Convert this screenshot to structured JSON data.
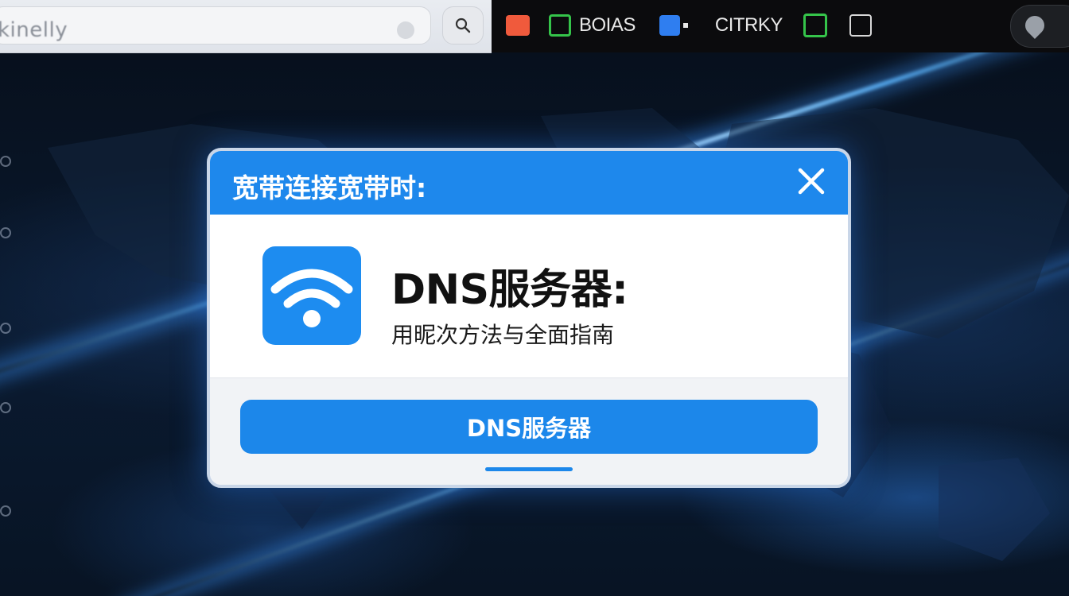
{
  "browser": {
    "address_text": "kinelly",
    "toolbar_items": [
      {
        "icon": "folder-icon",
        "color": "#f05a3c",
        "label": ""
      },
      {
        "icon": "chip-icon",
        "color": "#35c44a",
        "label": "BOIAS"
      },
      {
        "icon": "document-icon",
        "color": "#2f7ef0",
        "label": ""
      },
      {
        "icon": "",
        "color": "",
        "label": "CITRKY"
      },
      {
        "icon": "clipboard-icon",
        "color": "#35c44a",
        "label": ""
      },
      {
        "icon": "grid-icon",
        "color": "#d8d8d8",
        "label": ""
      }
    ]
  },
  "dialog": {
    "title": "宽带连接宽带时:",
    "heading": "DNS服务器:",
    "subtitle": "用昵次方法与全面指南",
    "button_label": "DNS服务器",
    "colors": {
      "accent": "#1e88ec",
      "tile": "#1d8cf0"
    }
  }
}
